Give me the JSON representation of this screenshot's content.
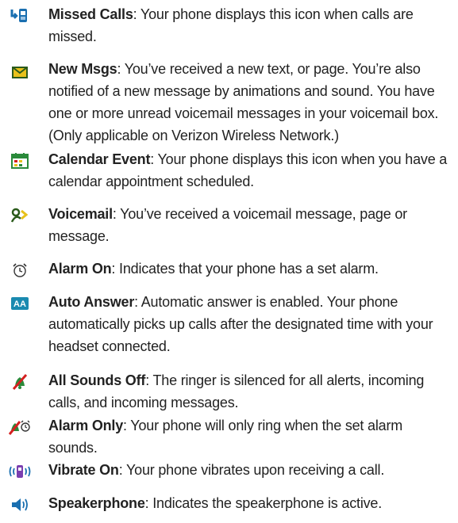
{
  "entries": [
    {
      "term": "Missed Calls",
      "desc": ": Your phone displays this icon when calls are missed.",
      "icon": "missed-calls-icon"
    },
    {
      "term": "New Msgs",
      "desc": ": You’ve received a new text, or page. You’re also notified of a new message by animations and sound. You have one or more unread voicemail messages in your voicemail box. (Only applicable on Verizon Wireless Network.)",
      "icon": "envelope-icon"
    },
    {
      "term": "Calendar Event",
      "desc": ": Your phone displays this icon when you have a calendar appointment scheduled.",
      "icon": "calendar-icon"
    },
    {
      "term": "Voicemail",
      "desc": ": You’ve received a voicemail message, page or message.",
      "icon": "voicemail-icon"
    },
    {
      "term": "Alarm On",
      "desc": ": Indicates that your phone has a set alarm.",
      "icon": "alarm-clock-icon"
    },
    {
      "term": "Auto Answer",
      "desc": ": Automatic answer is enabled. Your phone automatically picks up calls after the designated time with your headset connected.",
      "icon": "auto-answer-icon"
    },
    {
      "term": "All Sounds Off",
      "desc": ": The ringer is silenced for all alerts, incoming calls, and incoming messages.",
      "icon": "sounds-off-icon"
    },
    {
      "term": "Alarm Only",
      "desc": ": Your phone will only ring when the set alarm sounds.",
      "icon": "alarm-only-icon"
    },
    {
      "term": "Vibrate On",
      "desc": ": Your phone vibrates upon receiving a call.",
      "icon": "vibrate-icon"
    },
    {
      "term": "Speakerphone",
      "desc": ": Indicates the speakerphone is active.",
      "icon": "speakerphone-icon"
    }
  ],
  "colors": {
    "text": "#222222",
    "icon_blue": "#1a6fb0",
    "icon_red": "#d42020",
    "icon_green": "#2a8a3a",
    "icon_yellow": "#e8c11a"
  }
}
